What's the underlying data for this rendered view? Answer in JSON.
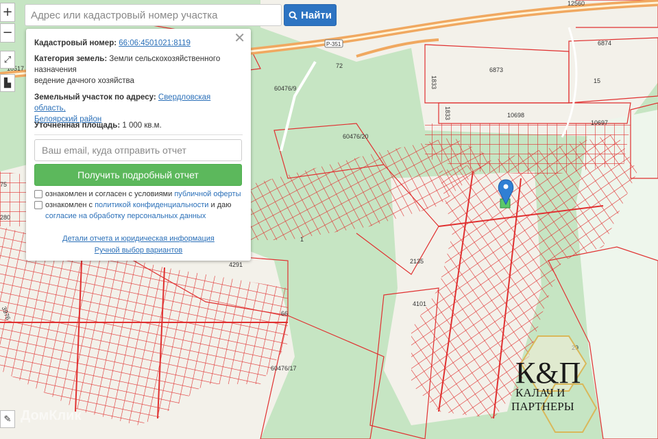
{
  "search": {
    "placeholder": "Адрес или кадастровый номер участка",
    "button_label": "Найти"
  },
  "zoom": {
    "in": "+",
    "out": "−"
  },
  "panel": {
    "close": "✕",
    "cadastral_label": "Кадастровый номер:",
    "cadastral_value": "66:06:4501021:8119",
    "category_label": "Категория земель:",
    "category_value": "Земли сельскохозяйственного назначения",
    "category_use": "ведение дачного хозяйства",
    "address_label": "Земельный участок по адресу:",
    "address_region": "Свердловская область,",
    "address_district": "Белоярский район",
    "area_label": "Уточненная площадь:",
    "area_value": "1 000 кв.м.",
    "email_placeholder": "Ваш email, куда отправить отчет",
    "report_button": "Получить подробный отчет",
    "consent1_text": "ознакомлен и согласен с условиями ",
    "consent1_link": "публичной оферты",
    "consent2_text": "ознакомлен с ",
    "consent2_link": "политикой конфиденциальности",
    "consent2_tail": " и даю",
    "consent2_link2": "согласие на обработку персональных данных",
    "details_link": "Детали отчета и юридическая информация",
    "manual_link": "Ручной выбор вариантов"
  },
  "map_labels": {
    "l12560": "12560",
    "l6874": "6874",
    "l6873": "6873",
    "l15": "15",
    "l1833a": "1833",
    "l1833b": "1833",
    "l10698": "10698",
    "l10697": "10697",
    "l60476_9": "60476/9",
    "l60476_20": "60476/20",
    "l60476_17": "60476/17",
    "l10517": "10517",
    "l4291": "4291",
    "l2135": "2135",
    "l4101": "4101",
    "l66": "66",
    "l29": "29",
    "l1": "1",
    "l175": "75",
    "l280": "280",
    "l3976": "3976",
    "road": "Р-351",
    "l72": "72"
  },
  "watermark": "ДомКлик",
  "logo": {
    "monogram": "К&П",
    "line1": "КАЛАЧ И",
    "line2": "ПАРТНЕРЫ"
  },
  "colors": {
    "parcel_line": "#e03030",
    "forest": "#c6e5c3",
    "field": "#f3f1ea",
    "road": "#f0a860",
    "marker": "#2f7fd4",
    "logo_gold": "#d9b85a"
  }
}
